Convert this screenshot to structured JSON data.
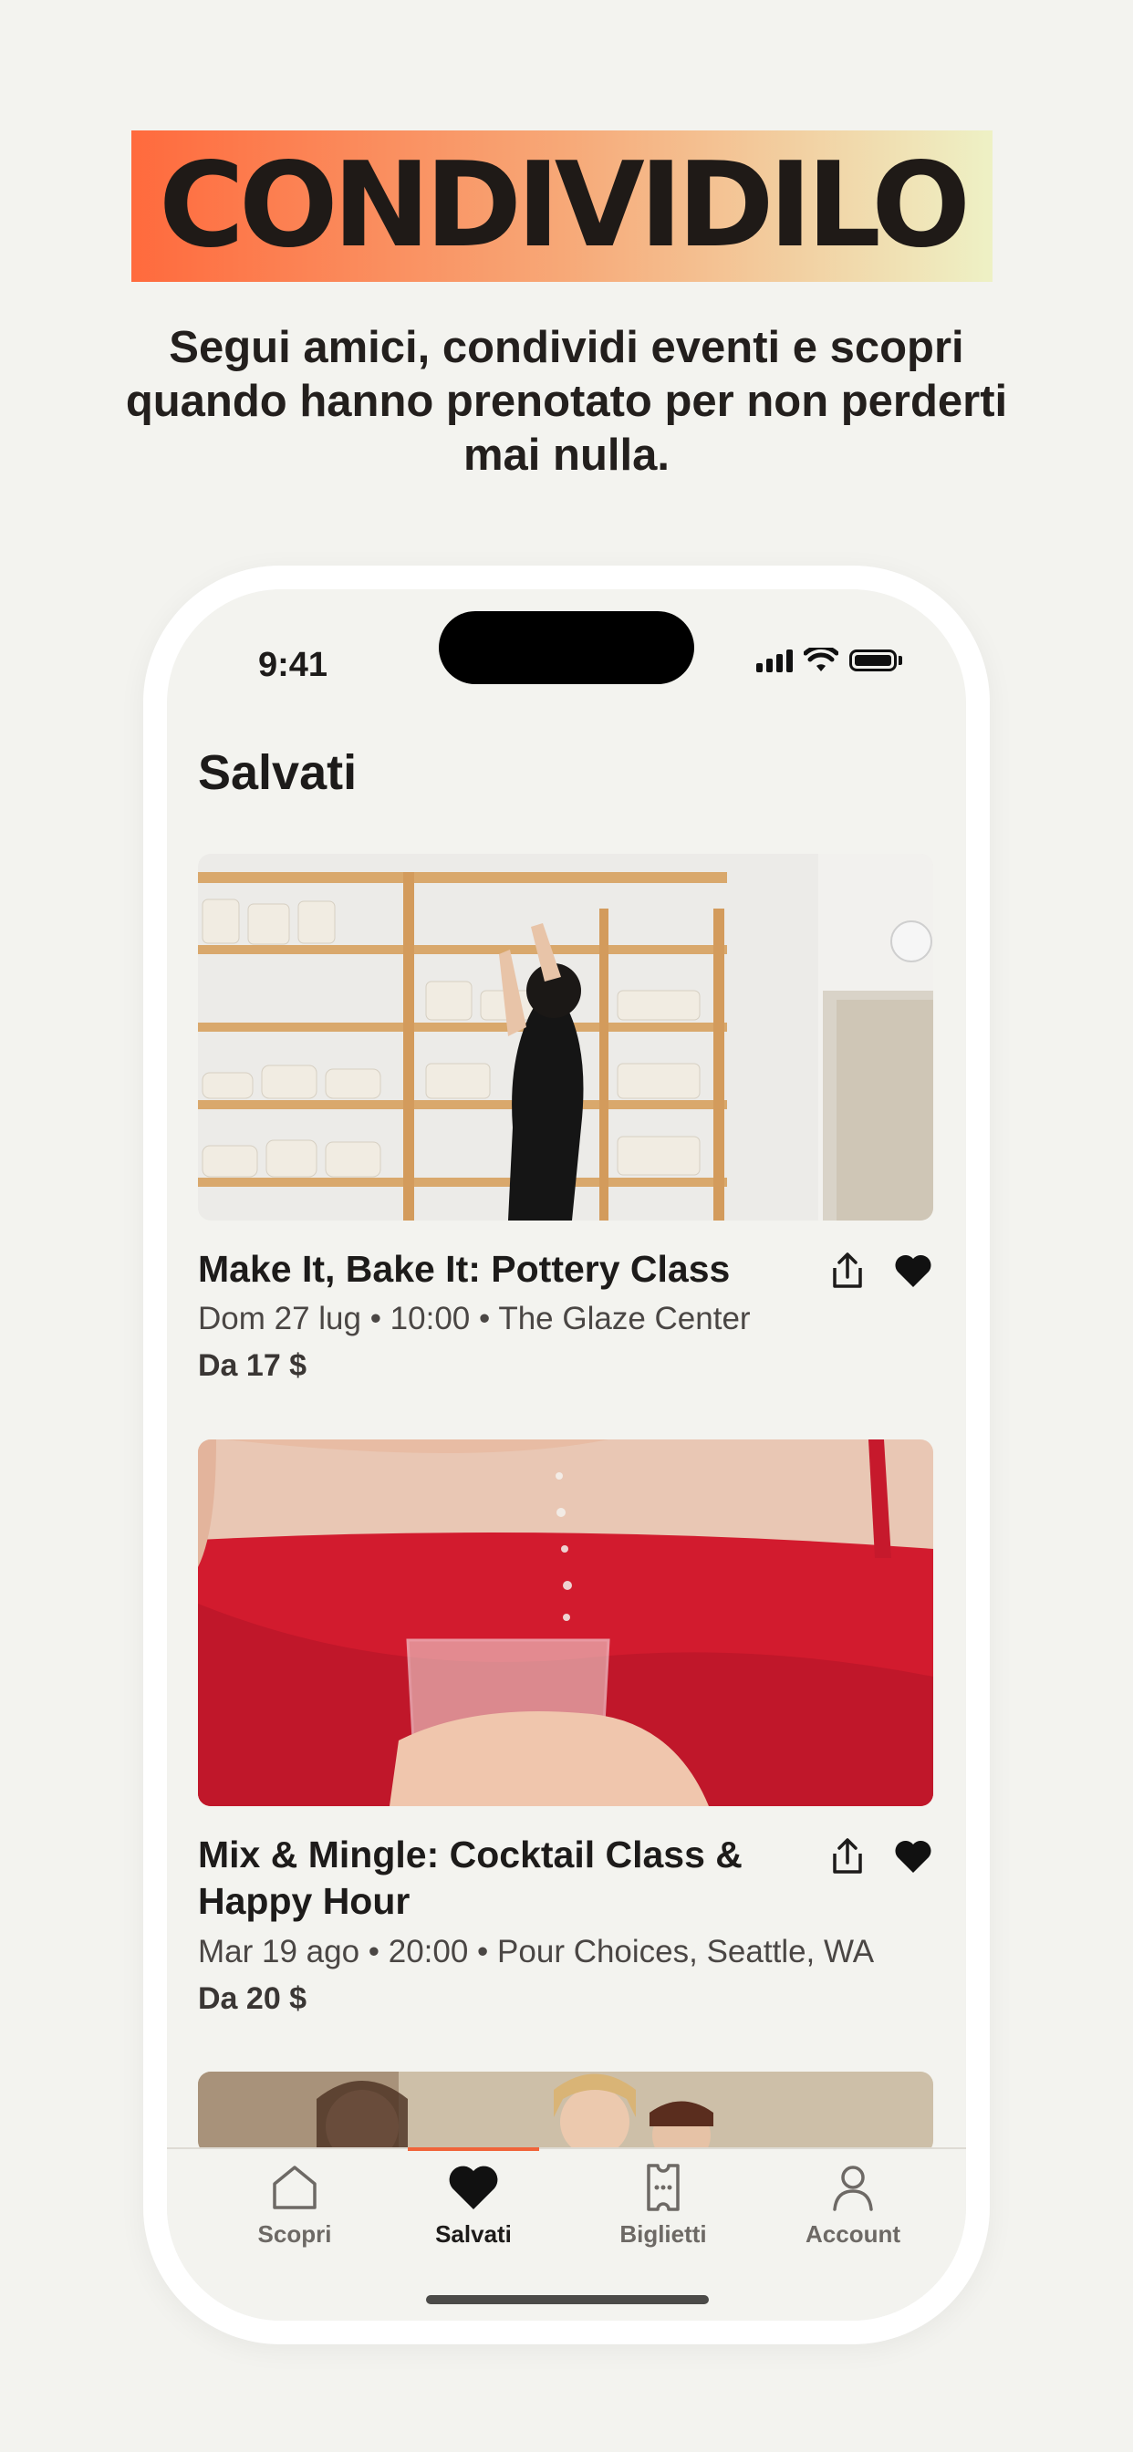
{
  "promo": {
    "headline": "CONDIVIDILO",
    "subheadline": "Segui amici, condividi eventi e scopri quando hanno prenotato per non perderti mai nulla."
  },
  "status_bar": {
    "time": "9:41"
  },
  "screen": {
    "title": "Salvati"
  },
  "events": [
    {
      "title": "Make It, Bake It: Pottery Class",
      "meta": "Dom 27 lug • 10:00 • The Glaze Center",
      "price": "Da 17 $",
      "image": "pottery-studio-photo"
    },
    {
      "title": "Mix & Mingle: Cocktail Class & Happy Hour",
      "meta": "Mar 19 ago • 20:00 • Pour Choices, Seattle, WA",
      "price": "Da 20 $",
      "image": "cocktail-pour-photo"
    },
    {
      "image": "friends-laughing-photo"
    }
  ],
  "tabbar": {
    "tabs": [
      {
        "label": "Scopri",
        "icon": "house-icon",
        "active": false
      },
      {
        "label": "Salvati",
        "icon": "heart-icon",
        "active": true
      },
      {
        "label": "Biglietti",
        "icon": "ticket-icon",
        "active": false
      },
      {
        "label": "Account",
        "icon": "person-icon",
        "active": false
      }
    ]
  },
  "colors": {
    "accent": "#f0643a",
    "background": "#f3f3ef",
    "gradient_start": "#ff6a3d",
    "gradient_end": "#eef1c5"
  }
}
